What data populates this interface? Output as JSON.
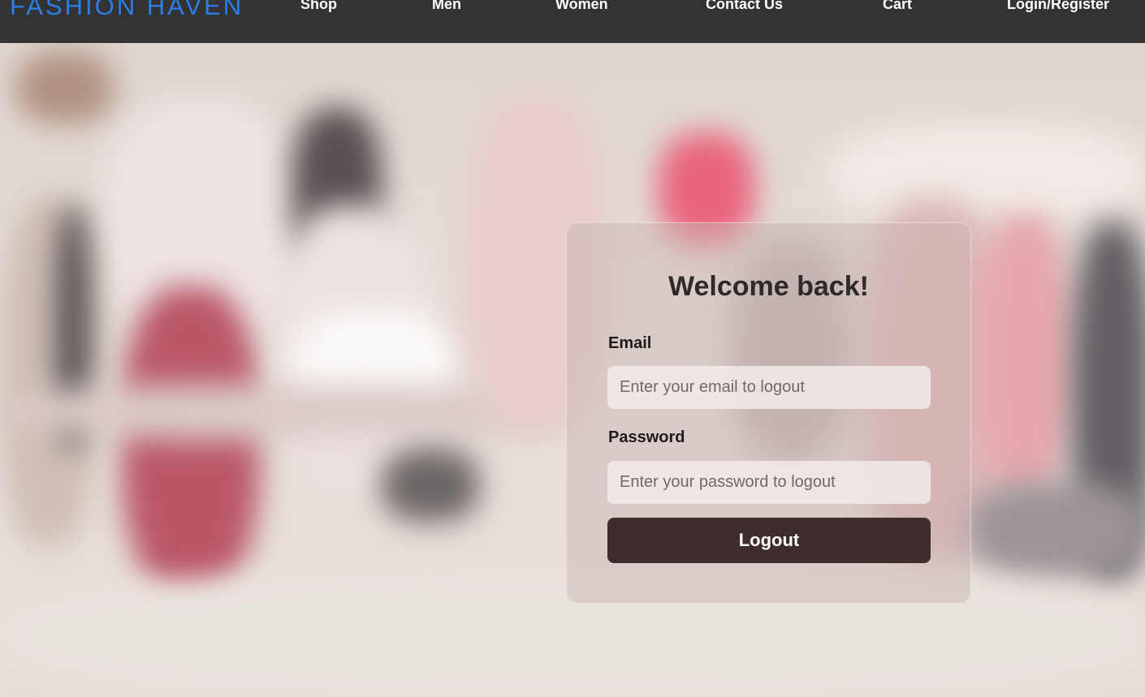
{
  "navbar": {
    "brand": "FASHION HAVEN",
    "items": [
      {
        "label": "Shop"
      },
      {
        "label": "Men"
      },
      {
        "label": "Women"
      },
      {
        "label": "Contact Us"
      },
      {
        "label": "Cart"
      },
      {
        "label": "Login/Register"
      }
    ]
  },
  "login_card": {
    "title": "Welcome back!",
    "email_label": "Email",
    "email_placeholder": "Enter your email to logout",
    "email_value": "",
    "password_label": "Password",
    "password_placeholder": "Enter your password to logout",
    "password_value": "",
    "submit_label": "Logout"
  },
  "colors": {
    "navbar_bg": "#333333",
    "brand": "#2b7de9",
    "button_bg": "#3e2d2c",
    "nav_text": "#ffffff"
  }
}
